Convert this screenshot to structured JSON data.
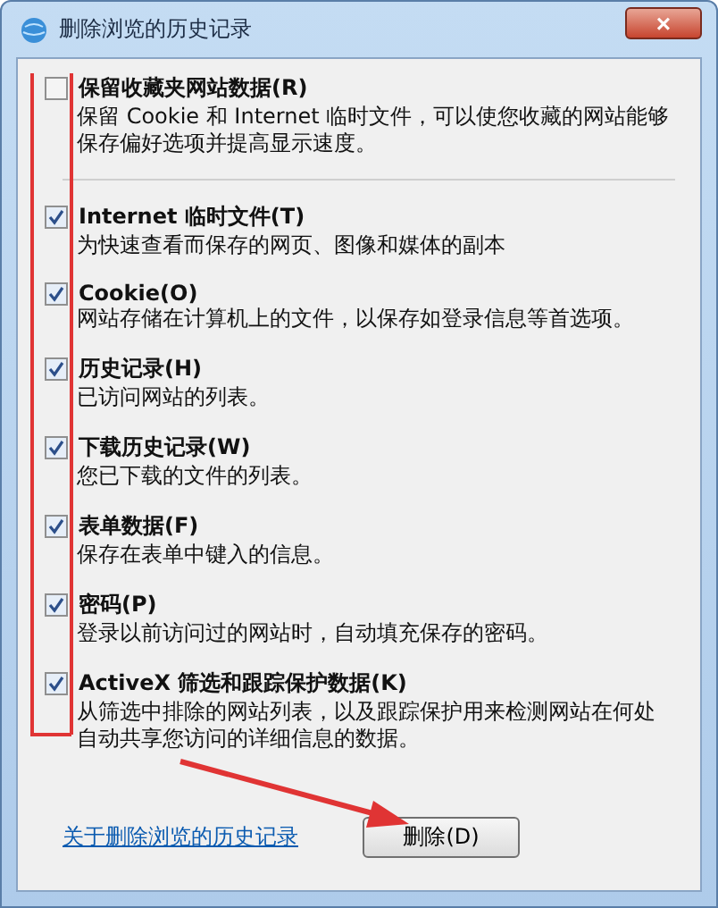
{
  "window": {
    "title": "删除浏览的历史记录",
    "close": "×"
  },
  "options": [
    {
      "label": "保留收藏夹网站数据(R)",
      "description": "保留 Cookie 和 Internet 临时文件，可以使您收藏的网站能够保存偏好选项并提高显示速度。",
      "checked": false
    },
    {
      "label": "Internet 临时文件(T)",
      "description": "为快速查看而保存的网页、图像和媒体的副本",
      "checked": true
    },
    {
      "label": "Cookie(O)",
      "description": "网站存储在计算机上的文件，以保存如登录信息等首选项。",
      "checked": true
    },
    {
      "label": "历史记录(H)",
      "description": "已访问网站的列表。",
      "checked": true
    },
    {
      "label": "下载历史记录(W)",
      "description": "您已下载的文件的列表。",
      "checked": true
    },
    {
      "label": "表单数据(F)",
      "description": "保存在表单中键入的信息。",
      "checked": true
    },
    {
      "label": "密码(P)",
      "description": "登录以前访问过的网站时，自动填充保存的密码。",
      "checked": true
    },
    {
      "label": "ActiveX 筛选和跟踪保护数据(K)",
      "description": "从筛选中排除的网站列表，以及跟踪保护用来检测网站在何处自动共享您访问的详细信息的数据。",
      "checked": true
    }
  ],
  "link": "关于删除浏览的历史记录",
  "button": "删除(D)"
}
